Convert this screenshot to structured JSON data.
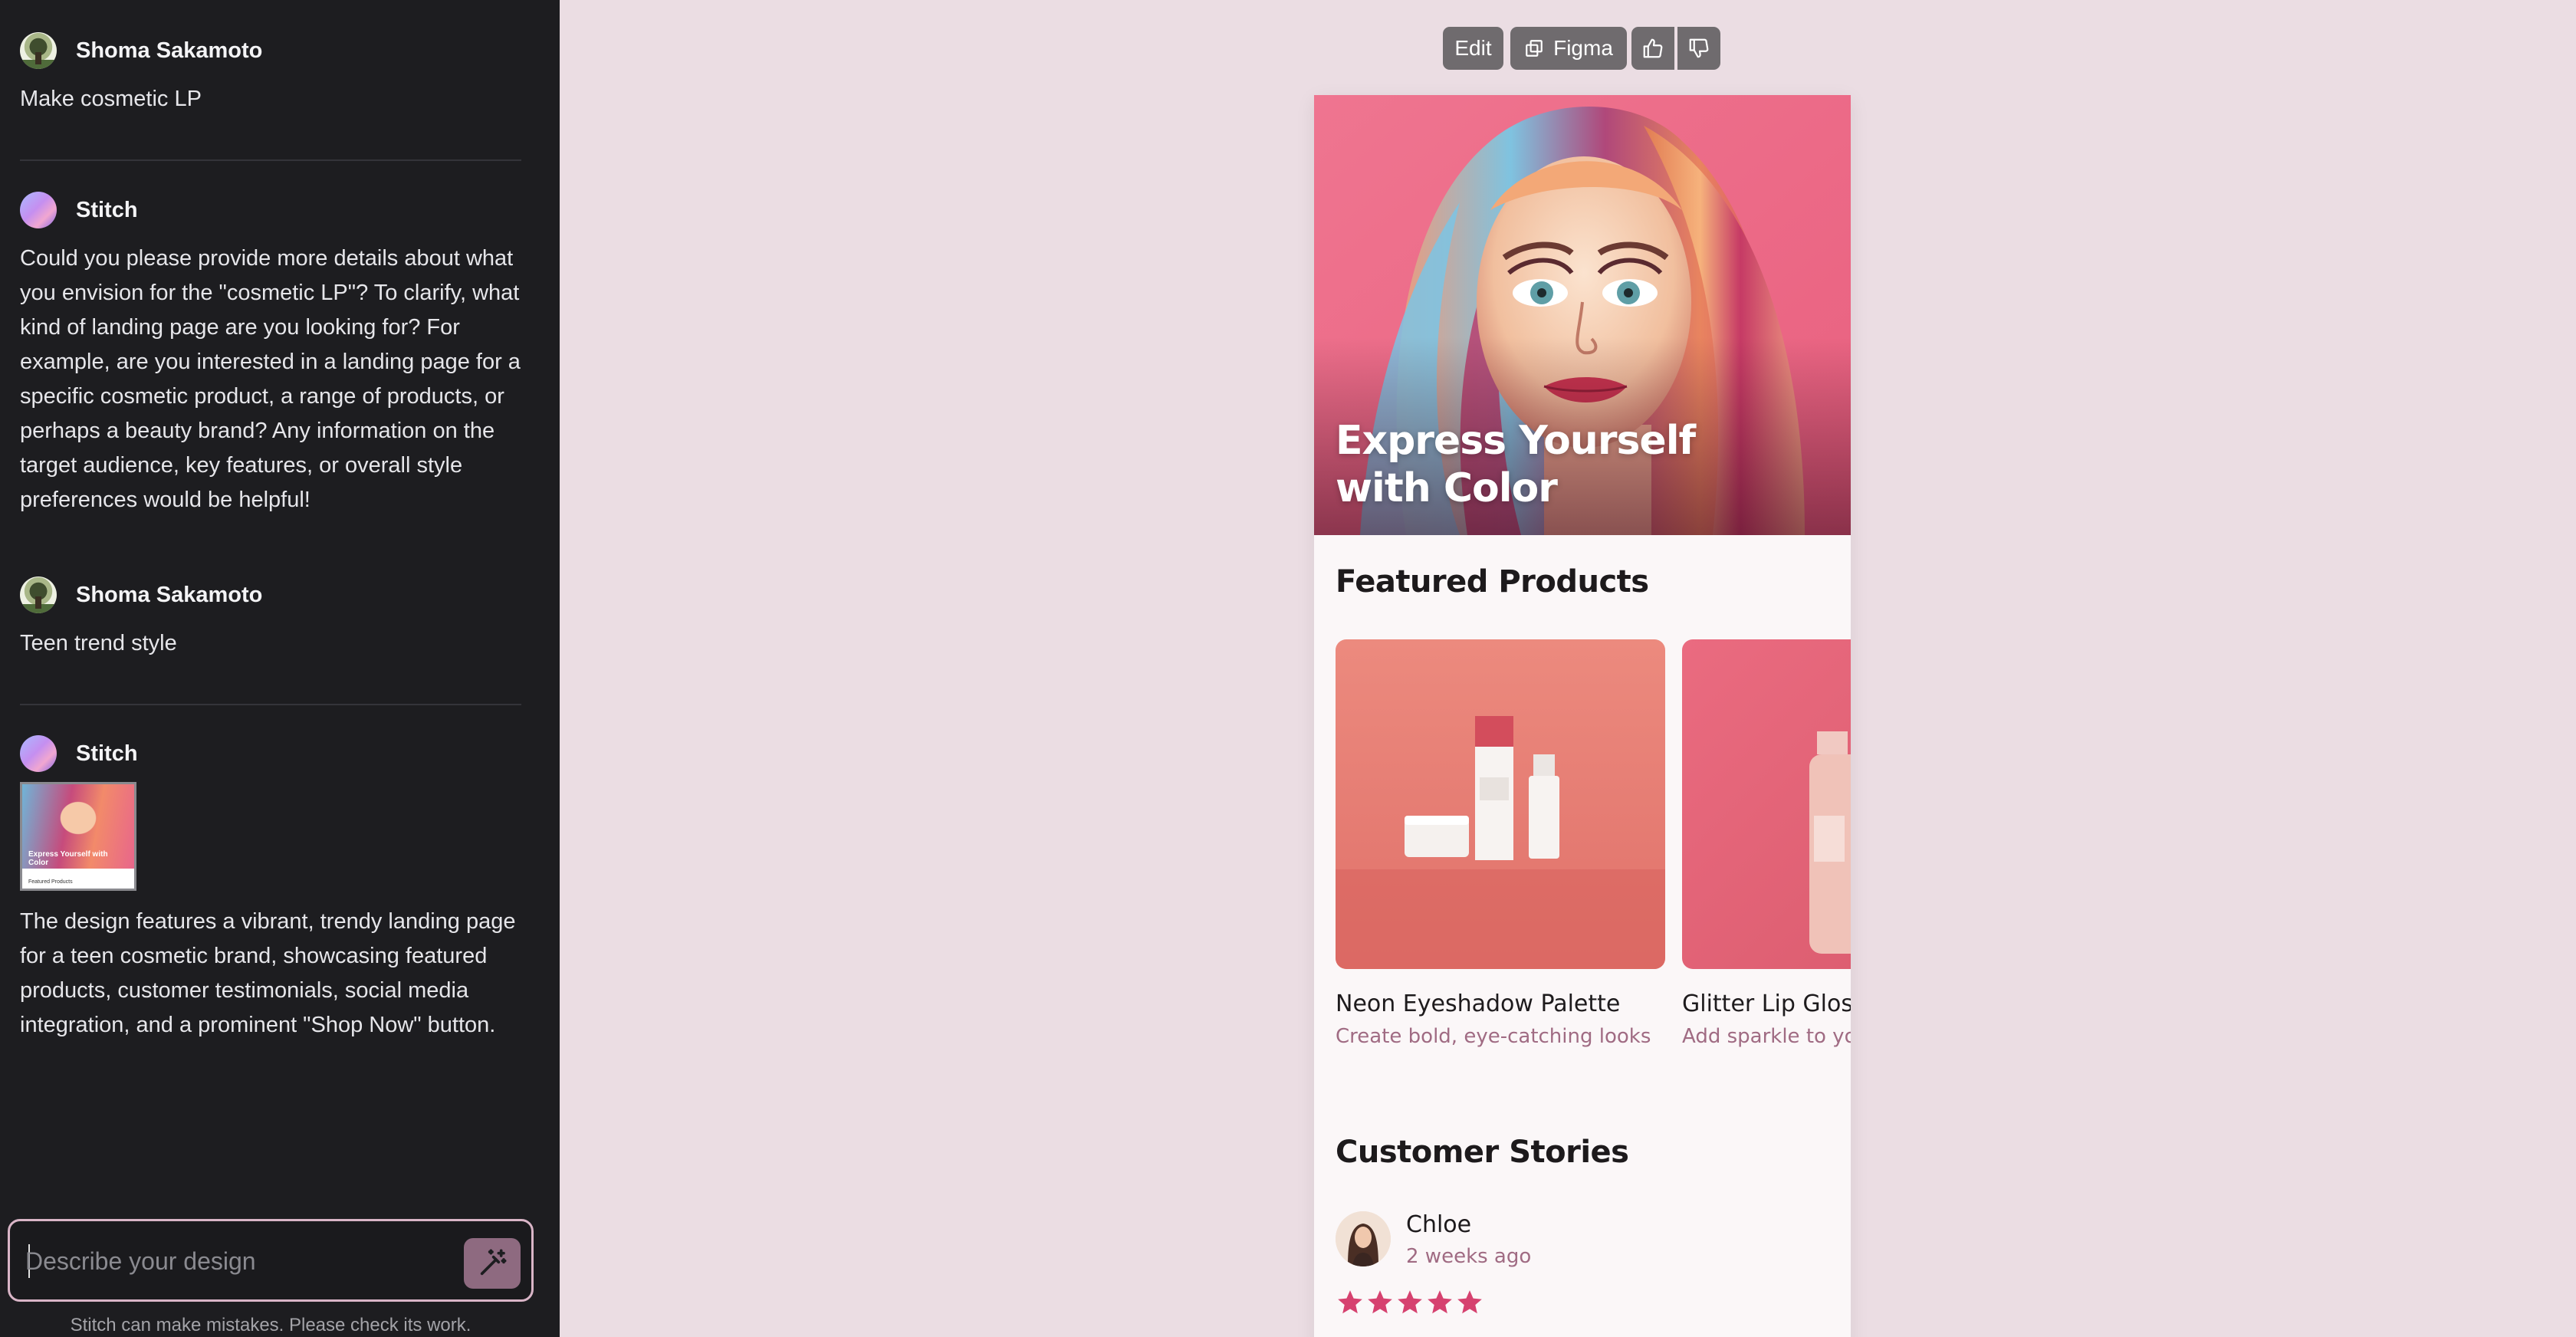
{
  "chat": {
    "messages": [
      {
        "author": "Shoma Sakamoto",
        "role": "user",
        "text": "Make cosmetic LP"
      },
      {
        "author": "Stitch",
        "role": "assistant",
        "text": "Could you please provide more details about what you envision for the \"cosmetic LP\"? To clarify, what kind of landing page are you looking for? For example, are you interested in a landing page for a specific cosmetic product, a range of products, or perhaps a beauty brand? Any information on the target audience, key features, or overall style preferences would be helpful!"
      },
      {
        "author": "Shoma Sakamoto",
        "role": "user",
        "text": "Teen trend style"
      },
      {
        "author": "Stitch",
        "role": "assistant",
        "text": "The design features a vibrant, trendy landing page for a teen cosmetic brand, showcasing featured products, customer testimonials, social media integration, and a prominent \"Shop Now\" button."
      }
    ],
    "thumbnail": {
      "title": "Express Yourself with Color",
      "subtitle": "Featured Products"
    },
    "prompt_placeholder": "Describe your design",
    "disclaimer": "Stitch can make mistakes. Please check its work."
  },
  "toolbar": {
    "edit_label": "Edit",
    "figma_label": "Figma",
    "like_icon": "thumbs-up-icon",
    "dislike_icon": "thumbs-down-icon"
  },
  "preview": {
    "hero_title": "Express Yourself with Color",
    "featured_title": "Featured Products",
    "products": [
      {
        "name": "Neon Eyeshadow Palette",
        "description": "Create bold, eye-catching looks"
      },
      {
        "name": "Glitter Lip Gloss",
        "description": "Add sparkle to your smile"
      }
    ],
    "stories_title": "Customer Stories",
    "review": {
      "name": "Chloe",
      "time": "2 weeks ago",
      "rating": 5
    }
  },
  "colors": {
    "sidebar_bg": "#1d1d20",
    "canvas_bg": "#ebdde3",
    "accent_pink": "#d6416f",
    "muted_rose": "#a06b83",
    "send_button": "#8e6a80"
  }
}
